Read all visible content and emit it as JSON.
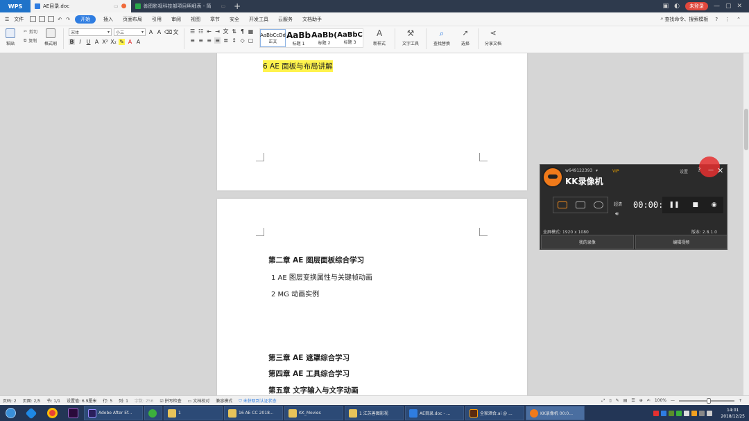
{
  "titlebar": {
    "app_name": "WPS",
    "tabs": [
      {
        "label": "AE目录.doc",
        "active": true
      },
      {
        "label": "善图影视科技部项目明细表 - 简",
        "active": false
      }
    ],
    "login_label": "未登录"
  },
  "menu": {
    "file_label": "文件",
    "items": [
      "开始",
      "插入",
      "页面布局",
      "引用",
      "审阅",
      "视图",
      "章节",
      "安全",
      "开发工具",
      "云服务",
      "文档助手"
    ],
    "search_label": "查找命令、搜索模板"
  },
  "ribbon": {
    "paste_label": "粘贴",
    "cut_label": "剪切",
    "copy_label": "复制",
    "format_painter_label": "格式刷",
    "font_name": "宋体",
    "font_size": "小三",
    "styles": [
      {
        "preview": "AaBbCcDd",
        "label": "正文"
      },
      {
        "preview": "AaBb",
        "label": "标题 1"
      },
      {
        "preview": "AaBb(",
        "label": "标题 2"
      },
      {
        "preview": "AaBbC",
        "label": "标题 3"
      }
    ],
    "new_style_label": "新样式",
    "text_tools_label": "文字工具",
    "find_replace_label": "查找替换",
    "select_label": "选择",
    "share_label": "分享文档"
  },
  "document": {
    "page1_line": "6 AE 面板与布局讲解",
    "chapter2_title": "第二章  AE 图层面板综合学习",
    "chapter2_item1": "1 AE 图层变换属性与关键帧动画",
    "chapter2_item2": "2 MG 动画实例",
    "chapter3_title": "第三章  AE 遮罩综合学习",
    "chapter4_title": "第四章  AE 工具综合学习",
    "chapter5_title": "第五章  文字输入与文字动画",
    "highlight_color": "#fff34d"
  },
  "recorder": {
    "user": "w649122393",
    "vip": "VIP",
    "title": "KK录像机",
    "settings_label": "设置",
    "quality_label": "超清",
    "time": "00:00:00",
    "mode_info": "全屏模式: 1920 x 1080",
    "version": "版本: 2.8.1.0",
    "my_recordings_label": "我的录像",
    "edit_video_label": "编辑视频",
    "accent_color": "#f08b1e"
  },
  "statusbar": {
    "page": "页码: 2",
    "pages": "页面: 2/5",
    "section": "节: 1/1",
    "setting_value": "设置值: 6.9厘米",
    "row": "行: 5",
    "col": "列: 1",
    "word_count": "字数: 256",
    "spell_check": "拼写检查",
    "doc_proof": "文档校对",
    "compat_mode": "兼容模式",
    "auth_status": "未获取到认证状态",
    "zoom": "100%"
  },
  "taskbar": {
    "tasks": [
      {
        "label": "Adobe After Ef...",
        "color": "#2a1f5c"
      },
      {
        "label": "",
        "color": "#3cb03c"
      },
      {
        "label": "1",
        "color": "#e8c45a"
      },
      {
        "label": "16 AE CC 2018...",
        "color": "#e8c45a"
      },
      {
        "label": "KK_Movies",
        "color": "#e8c45a"
      },
      {
        "label": "1 江苏善图影视",
        "color": "#e8c45a"
      },
      {
        "label": "AE目录.doc - ...",
        "color": "#2f7de1"
      },
      {
        "label": "全家酒合.ai @ ...",
        "color": "#5a2a10"
      },
      {
        "label": "KK录像机 00:0...",
        "color": "#f07a1a"
      }
    ],
    "time": "14:01",
    "date": "2018/12/25"
  }
}
